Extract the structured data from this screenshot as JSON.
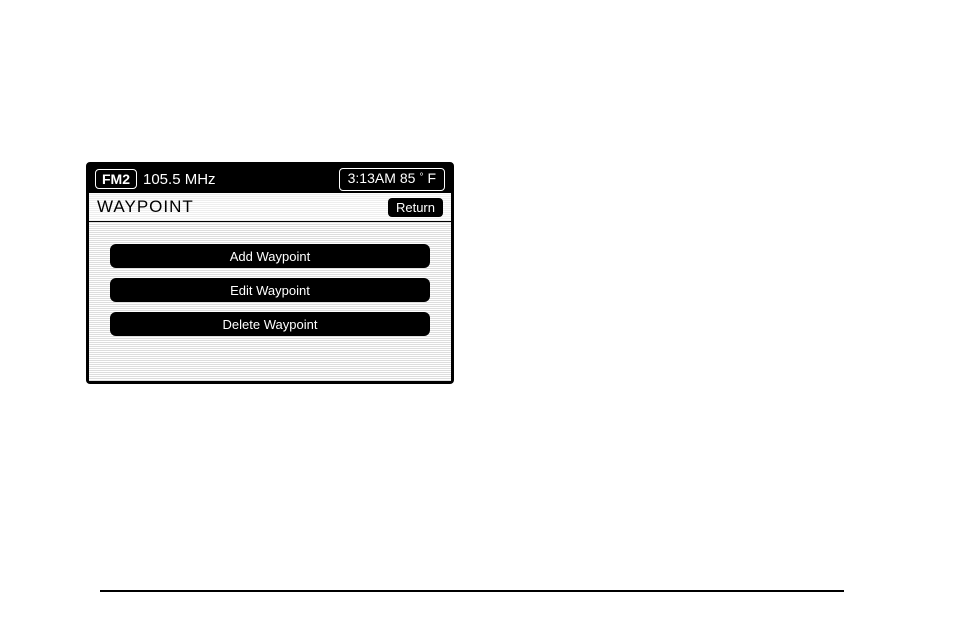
{
  "topbar": {
    "band": "FM2",
    "frequency": "105.5 MHz",
    "time": "3:13AM",
    "temp_value": "85",
    "temp_unit": "F"
  },
  "page": {
    "title": "WAYPOINT",
    "return_label": "Return"
  },
  "menu": {
    "items": [
      {
        "label": "Add Waypoint"
      },
      {
        "label": "Edit Waypoint"
      },
      {
        "label": "Delete Waypoint"
      }
    ]
  }
}
